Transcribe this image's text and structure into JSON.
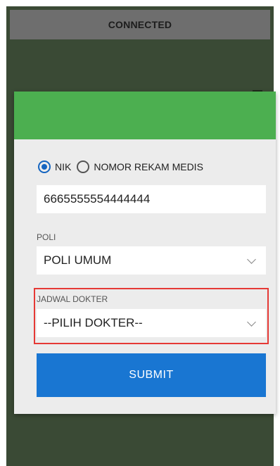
{
  "status_bar": {
    "text": "CONNECTED"
  },
  "form": {
    "id_type_options": [
      {
        "label": "NIK",
        "checked": true
      },
      {
        "label": "NOMOR REKAM MEDIS",
        "checked": false
      }
    ],
    "id_value": "6665555554444444",
    "poli_label": "POLI",
    "poli_value": "POLI UMUM",
    "jadwal_label": "JADWAL DOKTER",
    "jadwal_value": "--PILIH DOKTER--",
    "submit_label": "SUBMIT"
  },
  "colors": {
    "header_green": "#4caf50",
    "submit_blue": "#1976d2",
    "highlight_red": "#e53935"
  }
}
